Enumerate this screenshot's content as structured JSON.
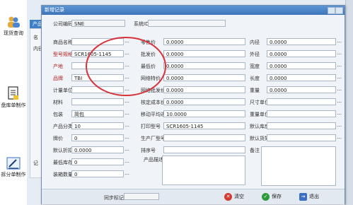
{
  "sidebar": {
    "items": [
      {
        "label": "现货查询",
        "icon": "people-icon"
      },
      {
        "label": "盘库单制作",
        "icon": "document-icon"
      },
      {
        "label": "拆分单制作",
        "icon": "pen-icon"
      }
    ]
  },
  "background": {
    "tab_title": "产品",
    "label_name": "名",
    "label_inner": "内径",
    "label_record": "记"
  },
  "dialog": {
    "title": "新增记录",
    "company_code_label": "公司编码",
    "company_code": "SNE",
    "system_id_label": "系统ID",
    "system_id": "",
    "col1": [
      {
        "label": "商品名称",
        "value": "",
        "red": false
      },
      {
        "label": "型号规格",
        "value": "SCR1605-1145",
        "red": true
      },
      {
        "label": "产地",
        "value": "",
        "red": true
      },
      {
        "label": "品牌",
        "value": "TBI",
        "red": true
      },
      {
        "label": "计量单位",
        "value": "",
        "red": false
      },
      {
        "label": "材料",
        "value": "",
        "red": false
      },
      {
        "label": "包装",
        "value": "简包",
        "red": false
      },
      {
        "label": "产品分类",
        "value": "10",
        "red": false
      },
      {
        "label": "牌价",
        "value": "0",
        "red": false
      },
      {
        "label": "默认折扣",
        "value": "0.0000",
        "red": false
      },
      {
        "label": "最低库存",
        "value": "0",
        "red": false
      },
      {
        "label": "装箱数量",
        "value": "0",
        "red": false
      }
    ],
    "col2": [
      {
        "label": "零售价",
        "value": "0.0000"
      },
      {
        "label": "批发价",
        "value": "0.0000"
      },
      {
        "label": "最低价",
        "value": "0.0000"
      },
      {
        "label": "网络特价",
        "value": "0.0000"
      },
      {
        "label": "网络批发价",
        "value": "0.0000"
      },
      {
        "label": "核定成本价",
        "value": "0.0000"
      },
      {
        "label": "移动平均进价",
        "value": "10.0000"
      },
      {
        "label": "打印型号",
        "value": "SCR1605-1145"
      },
      {
        "label": "生产厂型号",
        "value": ""
      },
      {
        "label": "排序号",
        "value": ""
      }
    ],
    "col3": [
      {
        "label": "内径",
        "value": "0.0000"
      },
      {
        "label": "外径",
        "value": "0.0000"
      },
      {
        "label": "宽度",
        "value": "0.0000"
      },
      {
        "label": "长度",
        "value": "0.0000"
      },
      {
        "label": "重量",
        "value": "0.0000"
      },
      {
        "label": "尺寸单位",
        "value": ""
      },
      {
        "label": "重量单位",
        "value": ""
      },
      {
        "label": "默认库房",
        "value": ""
      },
      {
        "label": "默认货架",
        "value": ""
      }
    ],
    "description_label": "产品描述",
    "remarks_label": "备注",
    "sync_label": "同步标记",
    "sync_value": "",
    "buttons": {
      "clear": "清空",
      "save": "保存",
      "exit": "退出"
    },
    "colors": {
      "title_bar": "#3c74b8",
      "highlight_circle": "#d6333a",
      "clear_icon": "#d23a2f",
      "save_icon": "#2e9a3c",
      "exit_icon": "#3a6fc4"
    }
  }
}
